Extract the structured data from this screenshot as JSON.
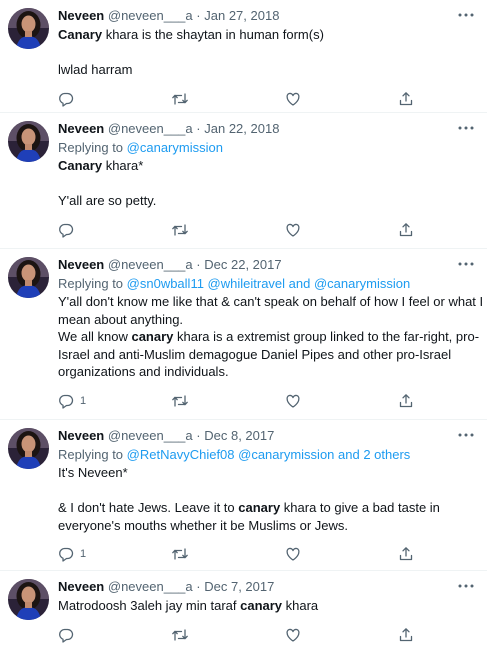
{
  "colors": {
    "link": "#1d9bf0",
    "muted": "#536471",
    "text": "#0f1419",
    "divider": "#eff3f4"
  },
  "icons": {
    "reply": "reply-icon",
    "retweet": "retweet-icon",
    "like": "like-icon",
    "share": "share-icon",
    "more": "more-icon"
  },
  "tweets": [
    {
      "name": "Neveen",
      "handle": "@neveen___a",
      "dot": "·",
      "date": "Jan 27, 2018",
      "replying": null,
      "body": {
        "p1a": "Canary",
        "p1b": " khara is the shaytan in human form(s)",
        "p2": "lwlad harram"
      },
      "reply_count": ""
    },
    {
      "name": "Neveen",
      "handle": "@neveen___a",
      "dot": "·",
      "date": "Jan 22, 2018",
      "replying": {
        "prefix": "Replying to ",
        "to": "@canarymission"
      },
      "body": {
        "p1a": "Canary",
        "p1b": " khara*",
        "p2": "Y'all are so petty."
      },
      "reply_count": ""
    },
    {
      "name": "Neveen",
      "handle": "@neveen___a",
      "dot": "·",
      "date": "Dec 22, 2017",
      "replying": {
        "prefix": "Replying to ",
        "to": "@sn0wball11 @whileitravel and @canarymission"
      },
      "body": {
        "l1": "Y'all don't know me like that & can't speak on behalf of how I feel or what I",
        "l2": "mean about anything.",
        "l3a": "We all know ",
        "l3b": "canary",
        "l3c": " khara is a extremist group linked to the far-right, pro-",
        "l4": "Israel and anti-Muslim demagogue Daniel Pipes and other pro-Israel",
        "l5": "organizations and individuals."
      },
      "reply_count": "1"
    },
    {
      "name": "Neveen",
      "handle": "@neveen___a",
      "dot": "·",
      "date": "Dec 8, 2017",
      "replying": {
        "prefix": "Replying to ",
        "to": "@RetNavyChief08 @canarymission and 2 others"
      },
      "body": {
        "p1": "It's Neveen*",
        "l2a": "& I don't hate Jews. Leave it to ",
        "l2b": "canary",
        "l2c": " khara to give a bad taste in",
        "l3": "everyone's mouths whether it be Muslims or Jews."
      },
      "reply_count": "1"
    },
    {
      "name": "Neveen",
      "handle": "@neveen___a",
      "dot": "·",
      "date": "Dec 7, 2017",
      "replying": null,
      "body": {
        "p1a": "Matrodoosh 3aleh jay min taraf ",
        "p1b": "canary",
        "p1c": " khara"
      },
      "reply_count": ""
    }
  ]
}
